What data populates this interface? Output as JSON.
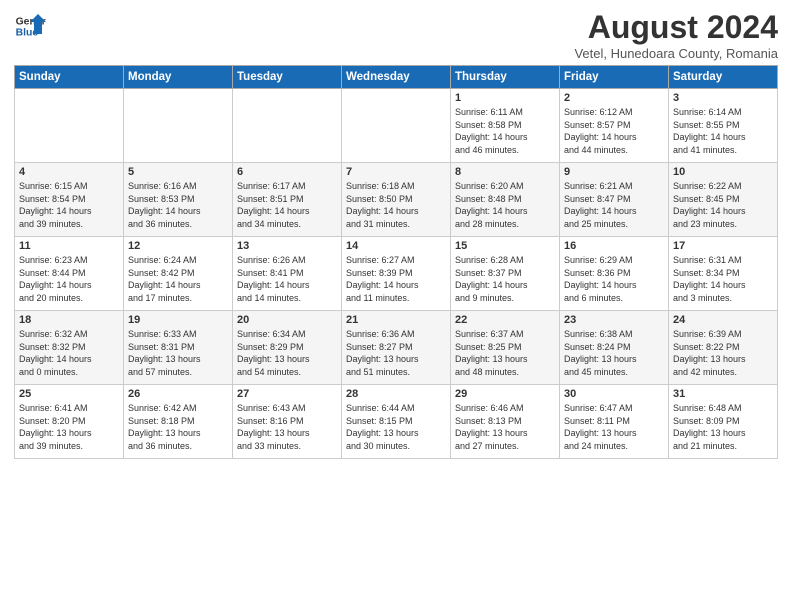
{
  "header": {
    "logo_line1": "General",
    "logo_line2": "Blue",
    "title": "August 2024",
    "subtitle": "Vetel, Hunedoara County, Romania"
  },
  "days_of_week": [
    "Sunday",
    "Monday",
    "Tuesday",
    "Wednesday",
    "Thursday",
    "Friday",
    "Saturday"
  ],
  "weeks": [
    [
      {
        "day": "",
        "text": ""
      },
      {
        "day": "",
        "text": ""
      },
      {
        "day": "",
        "text": ""
      },
      {
        "day": "",
        "text": ""
      },
      {
        "day": "1",
        "text": "Sunrise: 6:11 AM\nSunset: 8:58 PM\nDaylight: 14 hours\nand 46 minutes."
      },
      {
        "day": "2",
        "text": "Sunrise: 6:12 AM\nSunset: 8:57 PM\nDaylight: 14 hours\nand 44 minutes."
      },
      {
        "day": "3",
        "text": "Sunrise: 6:14 AM\nSunset: 8:55 PM\nDaylight: 14 hours\nand 41 minutes."
      }
    ],
    [
      {
        "day": "4",
        "text": "Sunrise: 6:15 AM\nSunset: 8:54 PM\nDaylight: 14 hours\nand 39 minutes."
      },
      {
        "day": "5",
        "text": "Sunrise: 6:16 AM\nSunset: 8:53 PM\nDaylight: 14 hours\nand 36 minutes."
      },
      {
        "day": "6",
        "text": "Sunrise: 6:17 AM\nSunset: 8:51 PM\nDaylight: 14 hours\nand 34 minutes."
      },
      {
        "day": "7",
        "text": "Sunrise: 6:18 AM\nSunset: 8:50 PM\nDaylight: 14 hours\nand 31 minutes."
      },
      {
        "day": "8",
        "text": "Sunrise: 6:20 AM\nSunset: 8:48 PM\nDaylight: 14 hours\nand 28 minutes."
      },
      {
        "day": "9",
        "text": "Sunrise: 6:21 AM\nSunset: 8:47 PM\nDaylight: 14 hours\nand 25 minutes."
      },
      {
        "day": "10",
        "text": "Sunrise: 6:22 AM\nSunset: 8:45 PM\nDaylight: 14 hours\nand 23 minutes."
      }
    ],
    [
      {
        "day": "11",
        "text": "Sunrise: 6:23 AM\nSunset: 8:44 PM\nDaylight: 14 hours\nand 20 minutes."
      },
      {
        "day": "12",
        "text": "Sunrise: 6:24 AM\nSunset: 8:42 PM\nDaylight: 14 hours\nand 17 minutes."
      },
      {
        "day": "13",
        "text": "Sunrise: 6:26 AM\nSunset: 8:41 PM\nDaylight: 14 hours\nand 14 minutes."
      },
      {
        "day": "14",
        "text": "Sunrise: 6:27 AM\nSunset: 8:39 PM\nDaylight: 14 hours\nand 11 minutes."
      },
      {
        "day": "15",
        "text": "Sunrise: 6:28 AM\nSunset: 8:37 PM\nDaylight: 14 hours\nand 9 minutes."
      },
      {
        "day": "16",
        "text": "Sunrise: 6:29 AM\nSunset: 8:36 PM\nDaylight: 14 hours\nand 6 minutes."
      },
      {
        "day": "17",
        "text": "Sunrise: 6:31 AM\nSunset: 8:34 PM\nDaylight: 14 hours\nand 3 minutes."
      }
    ],
    [
      {
        "day": "18",
        "text": "Sunrise: 6:32 AM\nSunset: 8:32 PM\nDaylight: 14 hours\nand 0 minutes."
      },
      {
        "day": "19",
        "text": "Sunrise: 6:33 AM\nSunset: 8:31 PM\nDaylight: 13 hours\nand 57 minutes."
      },
      {
        "day": "20",
        "text": "Sunrise: 6:34 AM\nSunset: 8:29 PM\nDaylight: 13 hours\nand 54 minutes."
      },
      {
        "day": "21",
        "text": "Sunrise: 6:36 AM\nSunset: 8:27 PM\nDaylight: 13 hours\nand 51 minutes."
      },
      {
        "day": "22",
        "text": "Sunrise: 6:37 AM\nSunset: 8:25 PM\nDaylight: 13 hours\nand 48 minutes."
      },
      {
        "day": "23",
        "text": "Sunrise: 6:38 AM\nSunset: 8:24 PM\nDaylight: 13 hours\nand 45 minutes."
      },
      {
        "day": "24",
        "text": "Sunrise: 6:39 AM\nSunset: 8:22 PM\nDaylight: 13 hours\nand 42 minutes."
      }
    ],
    [
      {
        "day": "25",
        "text": "Sunrise: 6:41 AM\nSunset: 8:20 PM\nDaylight: 13 hours\nand 39 minutes."
      },
      {
        "day": "26",
        "text": "Sunrise: 6:42 AM\nSunset: 8:18 PM\nDaylight: 13 hours\nand 36 minutes."
      },
      {
        "day": "27",
        "text": "Sunrise: 6:43 AM\nSunset: 8:16 PM\nDaylight: 13 hours\nand 33 minutes."
      },
      {
        "day": "28",
        "text": "Sunrise: 6:44 AM\nSunset: 8:15 PM\nDaylight: 13 hours\nand 30 minutes."
      },
      {
        "day": "29",
        "text": "Sunrise: 6:46 AM\nSunset: 8:13 PM\nDaylight: 13 hours\nand 27 minutes."
      },
      {
        "day": "30",
        "text": "Sunrise: 6:47 AM\nSunset: 8:11 PM\nDaylight: 13 hours\nand 24 minutes."
      },
      {
        "day": "31",
        "text": "Sunrise: 6:48 AM\nSunset: 8:09 PM\nDaylight: 13 hours\nand 21 minutes."
      }
    ]
  ]
}
